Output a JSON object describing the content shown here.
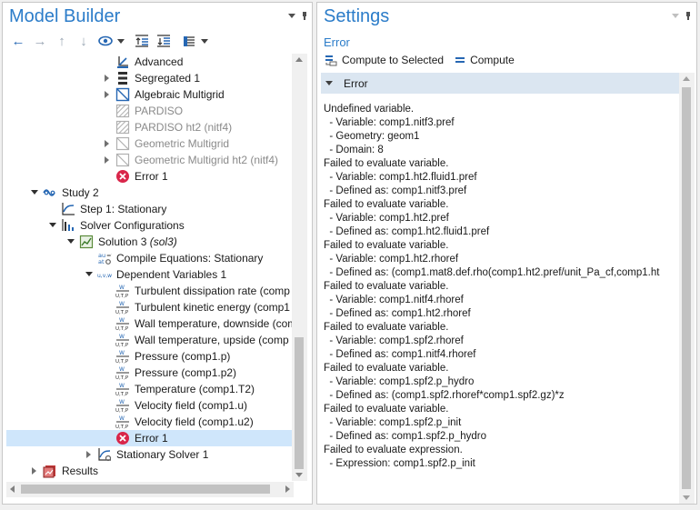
{
  "model_builder": {
    "title": "Model Builder",
    "toolbar": [
      "back-arrow-icon",
      "forward-arrow-icon",
      "move-up-icon",
      "move-down-icon",
      "show-icon",
      "expand-sections-icon",
      "collapse-sections-icon",
      "view-options-icon"
    ],
    "tree": [
      {
        "label": "Advanced",
        "icon": "advanced-icon",
        "grey": false
      },
      {
        "label": "Segregated 1",
        "icon": "segregated-icon",
        "grey": false
      },
      {
        "label": "Algebraic Multigrid",
        "icon": "multigrid-icon",
        "grey": false
      },
      {
        "label": "PARDISO",
        "icon": "direct-solver-icon",
        "grey": true
      },
      {
        "label": "PARDISO ht2 (nitf4)",
        "icon": "direct-solver-icon",
        "grey": true
      },
      {
        "label": "Geometric Multigrid",
        "icon": "multigrid-icon",
        "grey": true
      },
      {
        "label": "Geometric Multigrid ht2 (nitf4)",
        "icon": "multigrid-icon",
        "grey": true
      },
      {
        "label": "Error 1",
        "icon": "error-icon",
        "grey": false
      },
      {
        "label": "Study 2",
        "icon": "study-icon",
        "grey": false
      },
      {
        "label": "Step 1: Stationary",
        "icon": "stationary-step-icon",
        "grey": false
      },
      {
        "label": "Solver Configurations",
        "icon": "solver-configurations-icon",
        "grey": false
      },
      {
        "label": "Solution 3",
        "suffix": "(sol3)",
        "icon": "solution-icon",
        "grey": false
      },
      {
        "label": "Compile Equations: Stationary",
        "icon": "compile-equations-icon",
        "grey": false
      },
      {
        "label": "Dependent Variables 1",
        "icon": "dependent-variables-icon",
        "grey": false
      },
      {
        "label": "Turbulent dissipation rate (comp",
        "icon": "field-icon",
        "grey": false
      },
      {
        "label": "Turbulent kinetic energy (comp1",
        "icon": "field-icon",
        "grey": false
      },
      {
        "label": "Wall temperature, downside (com",
        "icon": "field-icon",
        "grey": false
      },
      {
        "label": "Wall temperature, upside (comp",
        "icon": "field-icon",
        "grey": false
      },
      {
        "label": "Pressure (comp1.p)",
        "icon": "field-icon",
        "grey": false
      },
      {
        "label": "Pressure (comp1.p2)",
        "icon": "field-icon",
        "grey": false
      },
      {
        "label": "Temperature (comp1.T2)",
        "icon": "field-icon",
        "grey": false
      },
      {
        "label": "Velocity field (comp1.u)",
        "icon": "field-icon",
        "grey": false
      },
      {
        "label": "Velocity field (comp1.u2)",
        "icon": "field-icon",
        "grey": false
      },
      {
        "label": "Error 1",
        "icon": "error-icon",
        "grey": false,
        "selected": true
      },
      {
        "label": "Stationary Solver 1",
        "icon": "stationary-solver-icon",
        "grey": false
      },
      {
        "label": "Results",
        "icon": "results-icon",
        "grey": false
      }
    ]
  },
  "settings": {
    "title": "Settings",
    "subtitle": "Error",
    "toolbar": {
      "compute_selected": "Compute to Selected",
      "compute": "Compute"
    },
    "section_title": "Error",
    "error_lines": [
      "Undefined variable.",
      "  - Variable: comp1.nitf3.pref",
      "  - Geometry: geom1",
      "  - Domain: 8",
      "Failed to evaluate variable.",
      "  - Variable: comp1.ht2.fluid1.pref",
      "  - Defined as: comp1.nitf3.pref",
      "Failed to evaluate variable.",
      "  - Variable: comp1.ht2.pref",
      "  - Defined as: comp1.ht2.fluid1.pref",
      "Failed to evaluate variable.",
      "  - Variable: comp1.ht2.rhoref",
      "  - Defined as: (comp1.mat8.def.rho(comp1.ht2.pref/unit_Pa_cf,comp1.ht",
      "Failed to evaluate variable.",
      "  - Variable: comp1.nitf4.rhoref",
      "  - Defined as: comp1.ht2.rhoref",
      "Failed to evaluate variable.",
      "  - Variable: comp1.spf2.rhoref",
      "  - Defined as: comp1.nitf4.rhoref",
      "Failed to evaluate variable.",
      "  - Variable: comp1.spf2.p_hydro",
      "  - Defined as: (comp1.spf2.rhoref*comp1.spf2.gz)*z",
      "Failed to evaluate variable.",
      "  - Variable: comp1.spf2.p_init",
      "  - Defined as: comp1.spf2.p_hydro",
      "Failed to evaluate expression.",
      "  - Expression: comp1.spf2.p_init"
    ]
  },
  "colors": {
    "title_blue": "#2b7cc9",
    "selection": "#cfe6fb",
    "section_header": "#dbe6f1",
    "error_red": "#d9264a"
  }
}
